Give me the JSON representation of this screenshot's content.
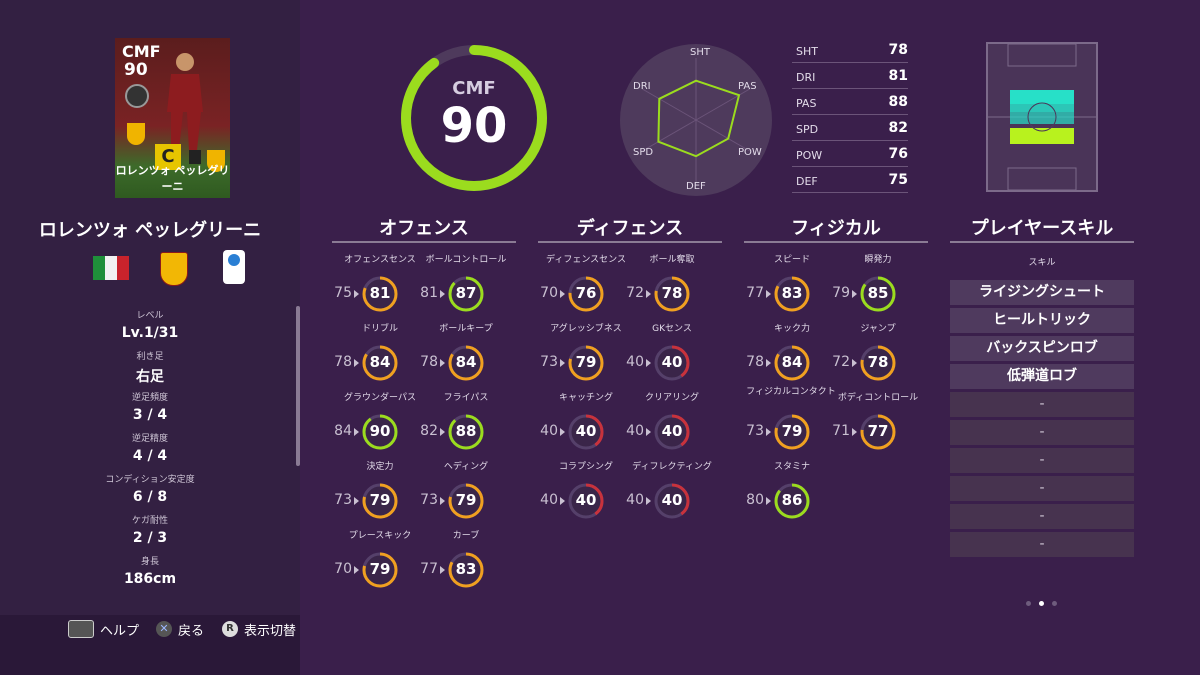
{
  "player": {
    "card_position": "CMF",
    "card_rating": "90",
    "card_grade": "C",
    "card_name": "ロレンツォ ペッレグリーニ",
    "name": "ロレンツォ ペッレグリーニ"
  },
  "profile": [
    {
      "label": "レベル",
      "value": "Lv.1/31"
    },
    {
      "label": "利き足",
      "value": "右足"
    },
    {
      "label": "逆足頻度",
      "value": "3 / 4"
    },
    {
      "label": "逆足精度",
      "value": "4 / 4"
    },
    {
      "label": "コンディション安定度",
      "value": "6 / 8"
    },
    {
      "label": "ケガ耐性",
      "value": "2 / 3"
    },
    {
      "label": "身長",
      "value": "186cm"
    }
  ],
  "footer": {
    "help": "ヘルプ",
    "back": "戻る",
    "toggle": "表示切替",
    "r_key": "R",
    "x_key": "✕"
  },
  "overall": {
    "position": "CMF",
    "rating": "90",
    "fraction": 0.9
  },
  "radar": {
    "labels": [
      "SHT",
      "PAS",
      "POW",
      "DEF",
      "SPD",
      "DRI"
    ],
    "values": [
      78,
      88,
      76,
      75,
      82,
      81
    ]
  },
  "stat_list": [
    {
      "key": "SHT",
      "value": "78"
    },
    {
      "key": "DRI",
      "value": "81"
    },
    {
      "key": "PAS",
      "value": "88"
    },
    {
      "key": "SPD",
      "value": "82"
    },
    {
      "key": "POW",
      "value": "76"
    },
    {
      "key": "DEF",
      "value": "75"
    }
  ],
  "categories": {
    "offense": "オフェンス",
    "defense": "ディフェンス",
    "physical": "フィジカル",
    "skills": "プレイヤースキル"
  },
  "offense": [
    {
      "label": "オフェンスセンス",
      "base": "75",
      "value": "81"
    },
    {
      "label": "ボールコントロール",
      "base": "81",
      "value": "87"
    },
    {
      "label": "ドリブル",
      "base": "78",
      "value": "84"
    },
    {
      "label": "ボールキープ",
      "base": "78",
      "value": "84"
    },
    {
      "label": "グラウンダーパス",
      "base": "84",
      "value": "90"
    },
    {
      "label": "フライパス",
      "base": "82",
      "value": "88"
    },
    {
      "label": "決定力",
      "base": "73",
      "value": "79"
    },
    {
      "label": "ヘディング",
      "base": "73",
      "value": "79"
    },
    {
      "label": "プレースキック",
      "base": "70",
      "value": "79"
    },
    {
      "label": "カーブ",
      "base": "77",
      "value": "83"
    }
  ],
  "defense": [
    {
      "label": "ディフェンスセンス",
      "base": "70",
      "value": "76"
    },
    {
      "label": "ボール奪取",
      "base": "72",
      "value": "78"
    },
    {
      "label": "アグレッシブネス",
      "base": "73",
      "value": "79"
    },
    {
      "label": "GKセンス",
      "base": "40",
      "value": "40"
    },
    {
      "label": "キャッチング",
      "base": "40",
      "value": "40"
    },
    {
      "label": "クリアリング",
      "base": "40",
      "value": "40"
    },
    {
      "label": "コラプシング",
      "base": "40",
      "value": "40"
    },
    {
      "label": "ディフレクティング",
      "base": "40",
      "value": "40"
    }
  ],
  "physical": [
    {
      "label": "スピード",
      "base": "77",
      "value": "83"
    },
    {
      "label": "瞬発力",
      "base": "79",
      "value": "85"
    },
    {
      "label": "キック力",
      "base": "78",
      "value": "84"
    },
    {
      "label": "ジャンプ",
      "base": "72",
      "value": "78"
    },
    {
      "label": "フィジカルコンタクト",
      "base": "73",
      "value": "79"
    },
    {
      "label": "ボディコントロール",
      "base": "71",
      "value": "77"
    },
    {
      "label": "スタミナ",
      "base": "80",
      "value": "86"
    }
  ],
  "skills": {
    "title": "スキル",
    "items": [
      "ライジングシュート",
      "ヒールトリック",
      "バックスピンロブ",
      "低弾道ロブ",
      "-",
      "-",
      "-",
      "-",
      "-",
      "-"
    ]
  },
  "colors": {
    "green": "#9bdc1e",
    "orange": "#f0a020",
    "red": "#c8323c",
    "cyan": "#27e0c8"
  }
}
